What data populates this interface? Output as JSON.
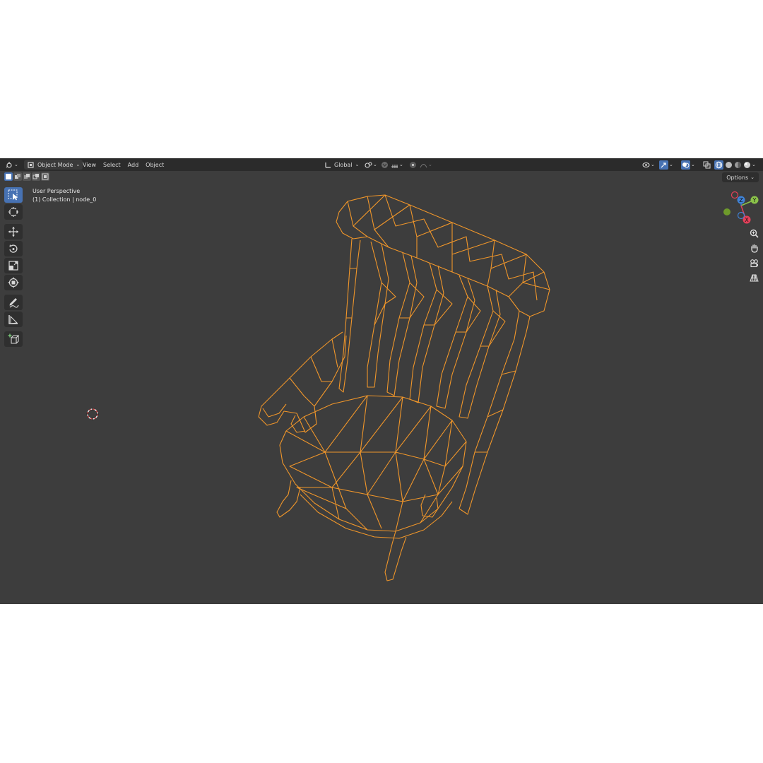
{
  "header": {
    "mode_label": "Object Mode",
    "menus": [
      "View",
      "Select",
      "Add",
      "Object"
    ],
    "transform_orientation": "Global"
  },
  "viewport": {
    "view_name": "User Perspective",
    "collection_info": "(1) Collection | node_0",
    "options_label": "Options"
  },
  "gizmo": {
    "x": "X",
    "y": "Y",
    "z": "Z"
  },
  "toolbar": {
    "tools": [
      "select-box",
      "cursor",
      "move",
      "rotate",
      "scale",
      "transform",
      "annotate",
      "measure",
      "add-cube"
    ],
    "active_tool": "select-box"
  },
  "colors": {
    "accent": "#4772b3",
    "wire": "#f0962a",
    "viewport_bg": "#3d3d3d",
    "header_bg": "#2b2b2b"
  },
  "icons": [
    "editor-type-icon",
    "object-mode-icon",
    "pivot-icon",
    "snap-icon",
    "proportional-icon",
    "visibility-icon",
    "gizmo-icon",
    "overlay-icon",
    "xray-icon",
    "shading-wire-icon",
    "shading-solid-icon",
    "shading-material-icon",
    "shading-rendered-icon",
    "zoom-icon",
    "pan-hand-icon",
    "camera-icon",
    "perspective-grid-icon",
    "3d-cursor-icon"
  ]
}
